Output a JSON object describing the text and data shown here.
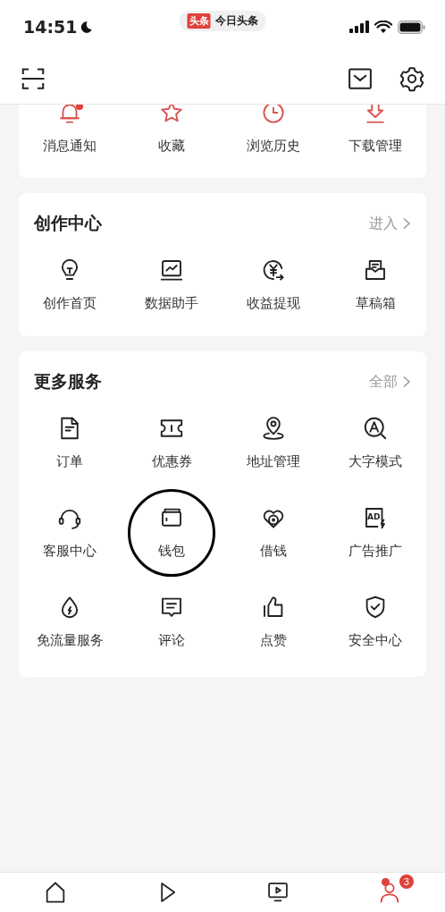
{
  "status_bar": {
    "time": "14:51",
    "app_pill": {
      "logo": "头条",
      "name": "今日头条"
    }
  },
  "top_card": {
    "items": [
      {
        "label": "消息通知",
        "notification_dot": true
      },
      {
        "label": "收藏",
        "notification_dot": false
      },
      {
        "label": "浏览历史",
        "notification_dot": false
      },
      {
        "label": "下载管理",
        "notification_dot": false
      }
    ]
  },
  "creator_center": {
    "title": "创作中心",
    "link": "进入",
    "items": [
      {
        "label": "创作首页"
      },
      {
        "label": "数据助手"
      },
      {
        "label": "收益提现"
      },
      {
        "label": "草稿箱"
      }
    ]
  },
  "more_services": {
    "title": "更多服务",
    "link": "全部",
    "items": [
      {
        "label": "订单",
        "circled": false
      },
      {
        "label": "优惠券",
        "circled": false
      },
      {
        "label": "地址管理",
        "circled": false
      },
      {
        "label": "大字模式",
        "circled": false
      },
      {
        "label": "客服中心",
        "circled": false
      },
      {
        "label": "钱包",
        "circled": true
      },
      {
        "label": "借钱",
        "circled": false
      },
      {
        "label": "广告推广",
        "circled": false,
        "icon_text": "AD"
      },
      {
        "label": "免流量服务",
        "circled": false
      },
      {
        "label": "评论",
        "circled": false
      },
      {
        "label": "点赞",
        "circled": false
      },
      {
        "label": "安全中心",
        "circled": false
      }
    ]
  },
  "bottom_nav": {
    "tabs": [
      {
        "selected": false,
        "dot": false
      },
      {
        "selected": false,
        "dot": false
      },
      {
        "selected": false,
        "dot": false
      },
      {
        "selected": true,
        "dot": true,
        "badge": "3"
      }
    ]
  }
}
